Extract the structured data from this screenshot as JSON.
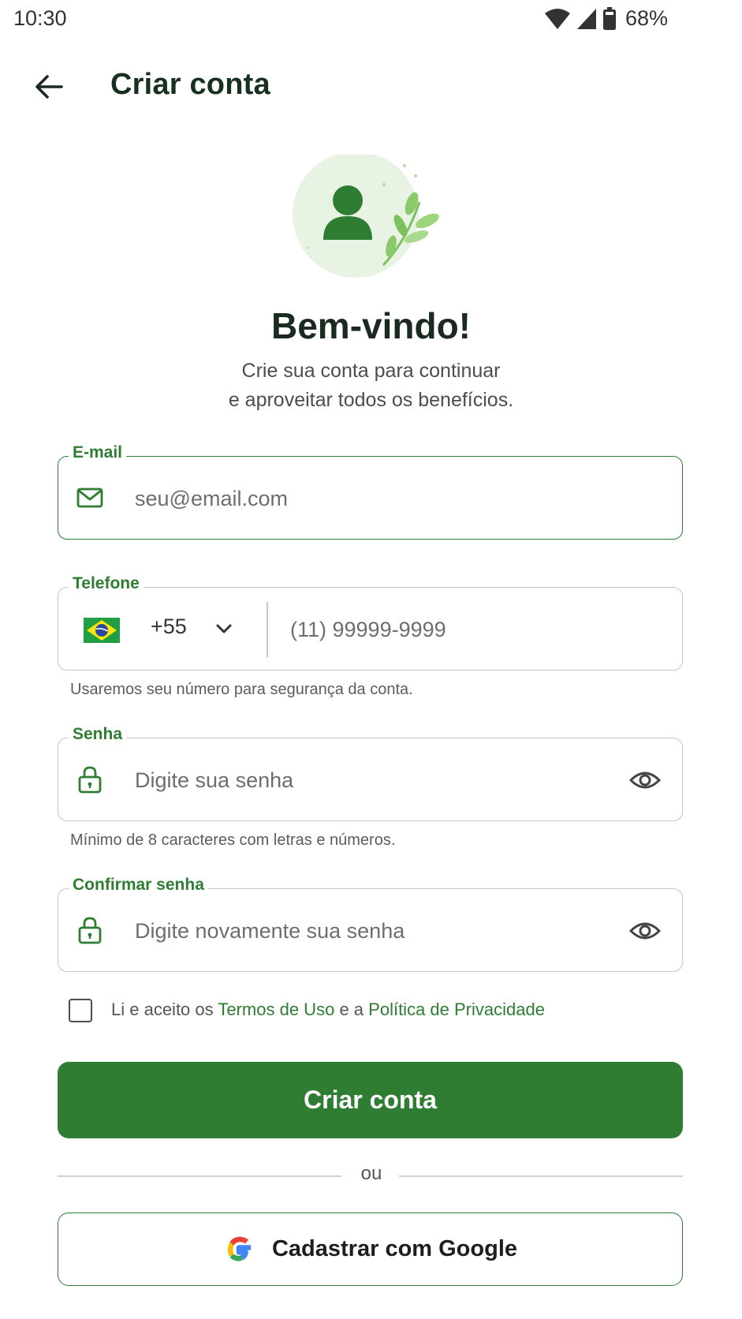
{
  "status_bar": {
    "time": "10:30",
    "battery": "68%"
  },
  "header": {
    "title": "Criar conta"
  },
  "hero": {
    "heading": "Bem-vindo!",
    "subtitle_line1": "Crie sua conta para continuar",
    "subtitle_line2": "e aproveitar todos os benefícios."
  },
  "form": {
    "email": {
      "label": "E-mail",
      "placeholder": "seu@email.com",
      "value": ""
    },
    "phone": {
      "label": "Telefone",
      "country_code": "+55",
      "placeholder": "(11) 99999-9999",
      "value": "",
      "helper": "Usaremos seu número para segurança da conta."
    },
    "password": {
      "label": "Senha",
      "placeholder": "Digite sua senha",
      "value": "",
      "helper": "Mínimo de 8 caracteres com letras e números."
    },
    "confirm_password": {
      "label": "Confirmar senha",
      "placeholder": "Digite novamente sua senha",
      "value": ""
    },
    "terms": {
      "checked": false,
      "prefix": "Li e aceito os",
      "terms_link": "Termos de Uso",
      "middle": "e a",
      "privacy_link": "Política de Privacidade"
    },
    "submit_label": "Criar conta",
    "divider_text": "ou",
    "google_label": "Cadastrar com Google"
  },
  "colors": {
    "primary": "#2e7d32",
    "hero_bg": "#e8f3e4",
    "leaf": "#7cc160"
  },
  "icons": [
    "back-arrow-icon",
    "mail-icon",
    "brazil-flag-icon",
    "chevron-down-icon",
    "lock-icon",
    "eye-icon",
    "google-icon",
    "wifi-icon",
    "signal-icon",
    "battery-icon",
    "user-icon"
  ]
}
